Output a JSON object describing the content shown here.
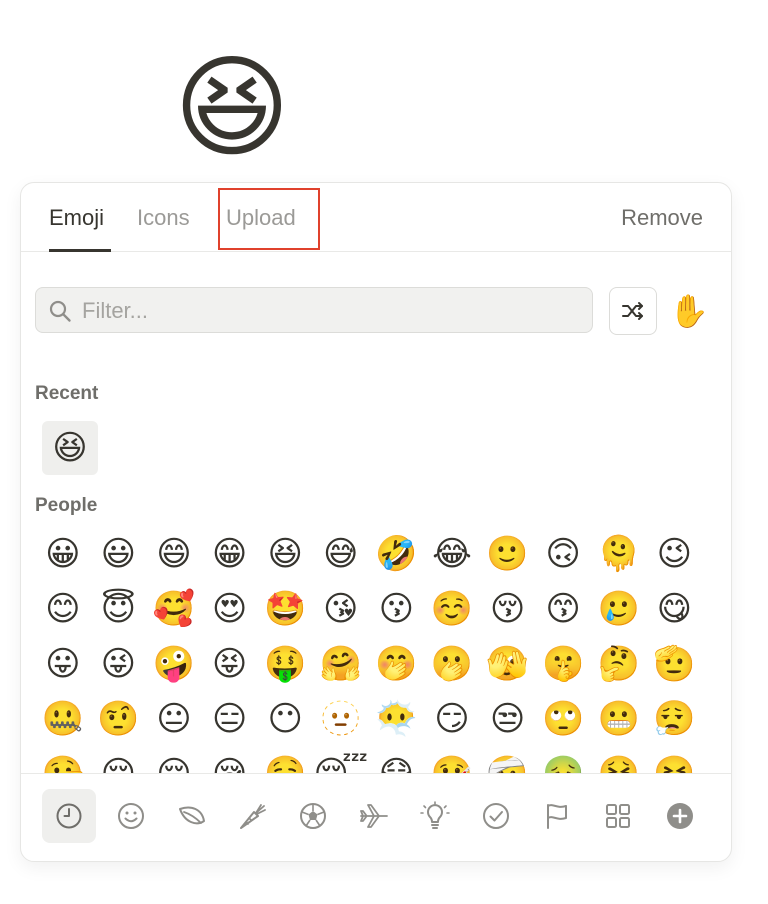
{
  "page_emoji": "😆",
  "tabs": [
    {
      "label": "Emoji",
      "active": true
    },
    {
      "label": "Icons",
      "active": false
    },
    {
      "label": "Upload",
      "active": false
    }
  ],
  "remove_label": "Remove",
  "filter": {
    "placeholder": "Filter..."
  },
  "icons": {
    "search": "search-icon",
    "shuffle": "shuffle-icon",
    "skin_tone": "raised-hand-icon"
  },
  "skin_tone_emoji": "✋",
  "recent": {
    "label": "Recent",
    "items": [
      "😆"
    ]
  },
  "people": {
    "label": "People",
    "emojis": [
      "😀",
      "😃",
      "😄",
      "😁",
      "😆",
      "😅",
      "🤣",
      "😂",
      "🙂",
      "🙃",
      "🫠",
      "😉",
      "😊",
      "😇",
      "🥰",
      "😍",
      "🤩",
      "😘",
      "😗",
      "☺️",
      "😚",
      "😙",
      "🥲",
      "😋",
      "😛",
      "😜",
      "🤪",
      "😝",
      "🤑",
      "🤗",
      "🤭",
      "🫢",
      "🫣",
      "🤫",
      "🤔",
      "🫡",
      "🤐",
      "🤨",
      "😐",
      "😑",
      "😶",
      "🫥",
      "😶‍🌫️",
      "😏",
      "😒",
      "🙄",
      "😬",
      "😮‍💨",
      "🤥",
      "😌",
      "😔",
      "😪",
      "🤤",
      "😴",
      "😷",
      "🤒",
      "🤕",
      "🤢",
      "🤮",
      "🤧"
    ]
  },
  "categories": [
    {
      "name": "recent",
      "active": true
    },
    {
      "name": "smileys",
      "active": false
    },
    {
      "name": "nature",
      "active": false
    },
    {
      "name": "food",
      "active": false
    },
    {
      "name": "activity",
      "active": false
    },
    {
      "name": "travel",
      "active": false
    },
    {
      "name": "objects",
      "active": false
    },
    {
      "name": "symbols",
      "active": false
    },
    {
      "name": "flags",
      "active": false
    },
    {
      "name": "custom",
      "active": false
    },
    {
      "name": "add",
      "active": false
    }
  ],
  "colors": {
    "highlight": "#e0412c",
    "text": "#37352f",
    "muted": "#9b9a97",
    "icon": "#8f8e8a"
  }
}
